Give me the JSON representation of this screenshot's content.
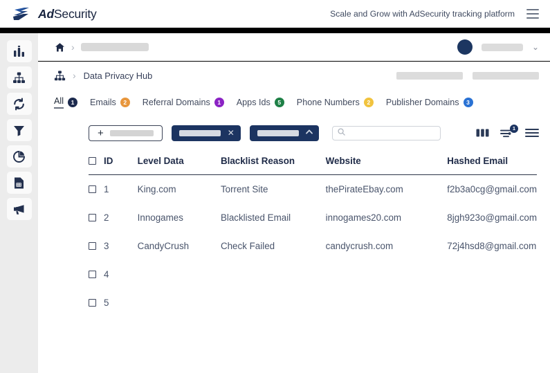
{
  "brand": {
    "logo_icon": "adsecurity-logo-icon",
    "name_bold": "Ad",
    "name_rest": "Security",
    "tagline": "Scale and Grow with AdSecurity tracking platform",
    "menu_icon": "hamburger-menu-icon"
  },
  "sidebar": {
    "items": [
      {
        "icon": "bar-chart-icon",
        "name": "analytics"
      },
      {
        "icon": "sitemap-icon",
        "name": "hierarchy"
      },
      {
        "icon": "sync-icon",
        "name": "sync"
      },
      {
        "icon": "funnel-icon",
        "name": "filters"
      },
      {
        "icon": "pie-chart-icon",
        "name": "reports"
      },
      {
        "icon": "calendar-doc-icon",
        "name": "schedules"
      },
      {
        "icon": "megaphone-icon",
        "name": "campaigns"
      }
    ]
  },
  "topbar": {
    "home_icon": "home-icon",
    "separator": "›",
    "crumb_placeholder": "",
    "avatar": "user-avatar",
    "user_placeholder": "",
    "chevron": "⌄"
  },
  "section": {
    "icon": "sitemap-icon",
    "separator": "›",
    "title": "Data Privacy Hub",
    "placeholder_1": "",
    "placeholder_2": ""
  },
  "tabs": [
    {
      "label": "All",
      "count": "1",
      "color": "#1c2a4e",
      "active": true
    },
    {
      "label": "Emails",
      "count": "2",
      "color": "#e8963c",
      "active": false
    },
    {
      "label": "Referral Domains",
      "count": "1",
      "color": "#8b23c4",
      "active": false
    },
    {
      "label": "Apps Ids",
      "count": "5",
      "color": "#1e8046",
      "active": false
    },
    {
      "label": "Phone Numbers",
      "count": "2",
      "color": "#f1c33e",
      "active": false
    },
    {
      "label": "Publisher Domains",
      "count": "3",
      "color": "#2a72d4",
      "active": false
    }
  ],
  "toolbar": {
    "add_button": {
      "icon": "plus-icon",
      "label": ""
    },
    "pill_1": {
      "label": "",
      "icon": "close-icon",
      "glyph": "✕"
    },
    "pill_2": {
      "label": "",
      "icon": "chevron-up-icon",
      "glyph": "︿"
    },
    "search": {
      "icon": "search-icon",
      "placeholder": "",
      "value": ""
    },
    "actions": [
      {
        "icon": "columns-icon",
        "name": "columns-toggle",
        "badge": ""
      },
      {
        "icon": "filter-sliders-icon",
        "name": "filters-toggle",
        "badge": "1"
      },
      {
        "icon": "list-menu-icon",
        "name": "row-density-menu",
        "badge": ""
      }
    ]
  },
  "table": {
    "select_all": "select-all-checkbox",
    "columns": [
      "ID",
      "Level Data",
      "Blacklist Reason",
      "Website",
      "Hashed Email"
    ],
    "rows": [
      {
        "id": "1",
        "level": "King.com",
        "reason": "Torrent Site",
        "website": "thePirateEbay.com",
        "email": "f2b3a0cg@gmail.com",
        "loading": false
      },
      {
        "id": "2",
        "level": "Innogames",
        "reason": "Blacklisted Email",
        "website": "innogames20.com",
        "email": "8jgh923o@gmail.com",
        "loading": false
      },
      {
        "id": "3",
        "level": "CandyCrush",
        "reason": "Check Failed",
        "website": "candycrush.com",
        "email": "72j4hsd8@gmail.com",
        "loading": false
      },
      {
        "id": "4",
        "level": "",
        "reason": "",
        "website": "",
        "email": "",
        "loading": true
      },
      {
        "id": "5",
        "level": "",
        "reason": "",
        "website": "",
        "email": "",
        "loading": true
      }
    ]
  },
  "colors": {
    "brand_navy": "#1c3461",
    "rail_bg": "#ececec",
    "text_dark": "#1e2a47",
    "text_body": "#49546b",
    "skeleton": "#c4c4c4"
  }
}
